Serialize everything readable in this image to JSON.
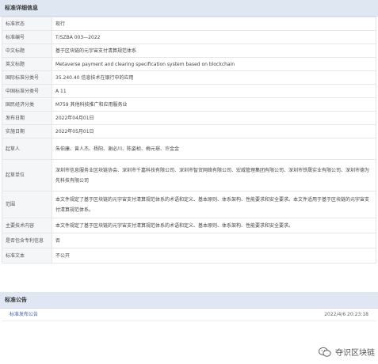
{
  "detail": {
    "header": "标准详细信息",
    "rows": [
      {
        "k": "标准状态",
        "v": "现行"
      },
      {
        "k": "标准编号",
        "v": "T/SZBA 003—2022"
      },
      {
        "k": "中文标题",
        "v": "基于区块链的元宇宙支付清算规范体系"
      },
      {
        "k": "英文标题",
        "v": "Metaverse payment and clearing specification system based on blockchain"
      },
      {
        "k": "国际标准分类号",
        "v": "35.240.40 信息技术在银行中的应用"
      },
      {
        "k": "中国标准分类号",
        "v": "A 11"
      },
      {
        "k": "国民经济分类",
        "v": "M759 其他科技推广和应用服务业"
      },
      {
        "k": "发布日期",
        "v": "2022年04月01日"
      },
      {
        "k": "实施日期",
        "v": "2022年05月01日"
      },
      {
        "k": "起草人",
        "v": "朱伯康、曾人杰、杨阳、谢必川、陈姿桢、梅元璟、许金金"
      },
      {
        "k": "起草单位",
        "v": "深圳市信息服务业区块链协会、深圳市千嘉科技有限公司、深圳市智贸网络有限公司、宏威管理集团有限公司、深圳市铁晟实业有限公司、深圳市德为先科技有限公司"
      },
      {
        "k": "范围",
        "v": "本文件规定了基于区块链的元宇宙支付清算规范体系的术语和定义、基本原则、体系架构、性能要求和安全要求。本文件适用于基于区块链的元宇宙支付清算规范体系。"
      },
      {
        "k": "主要技术内容",
        "v": "本文件规定了基于区块链的元宇宙支付清算规范体系的术语和定义、基本原则、体系架构、性能要求和安全要求。"
      },
      {
        "k": "是否包含专利信息",
        "v": "否"
      },
      {
        "k": "标准文本",
        "v": "不公开"
      }
    ]
  },
  "notice": {
    "header": "标准公告",
    "link": "标准发布公告",
    "date": "2022/4/6 20:23:18"
  },
  "watermark": {
    "text": "夺识区块链"
  }
}
